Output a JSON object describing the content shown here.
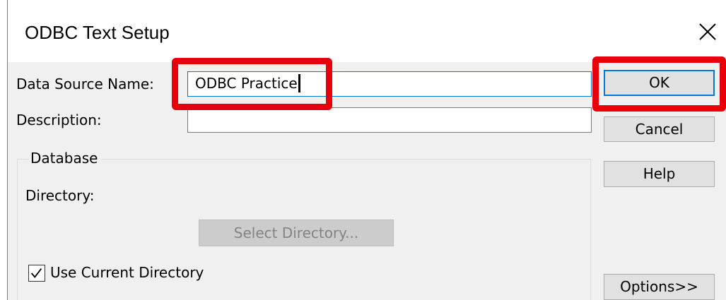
{
  "window": {
    "title": "ODBC Text Setup"
  },
  "form": {
    "dsn_label": "Data Source Name:",
    "dsn_value": "ODBC Practice",
    "description_label": "Description:",
    "description_value": ""
  },
  "database_group": {
    "legend": "Database",
    "directory_label": "Directory:",
    "directory_value": "",
    "select_directory_button": "Select Directory...",
    "use_current_directory_label": "Use Current Directory",
    "use_current_directory_checked": true
  },
  "buttons": {
    "ok": "OK",
    "cancel": "Cancel",
    "help": "Help",
    "options": "Options>>"
  },
  "annotations": {
    "highlight_color": "#e8000b"
  }
}
